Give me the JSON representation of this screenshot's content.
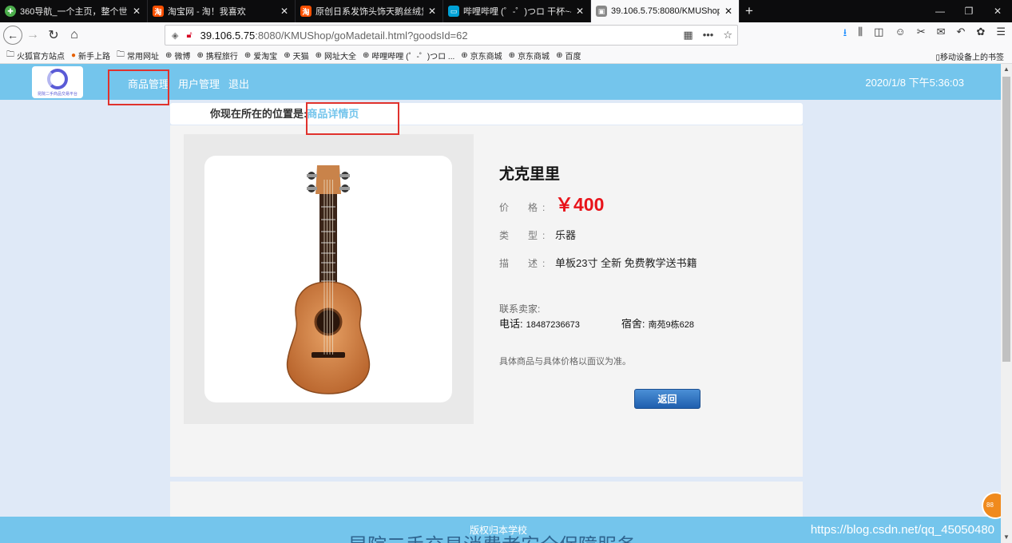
{
  "browser": {
    "tabs": [
      {
        "title": "360导航_一个主页，整个世界",
        "active": false,
        "fav_color": "#4cae4c"
      },
      {
        "title": "淘宝网 - 淘！我喜欢",
        "active": false,
        "fav_color": "#ff5000"
      },
      {
        "title": "原创日系发饰头饰天鹅丝绒复古",
        "active": false,
        "fav_color": "#ff5000"
      },
      {
        "title": "哔哩哔哩 (゜-゜)つロ 干杯~-bi",
        "active": false,
        "fav_color": "#00a1d6"
      },
      {
        "title": "39.106.5.75:8080/KMUShop/",
        "active": true,
        "fav_color": "#888888"
      }
    ],
    "url_host": "39.106.5.75",
    "url_rest": ":8080/KMUShop/goMadetail.html?goodsId=62",
    "bookmarks": [
      {
        "icon": "folder-icon",
        "label": "火狐官方站点"
      },
      {
        "icon": "firefox-icon",
        "label": "新手上路"
      },
      {
        "icon": "folder-icon",
        "label": "常用网址"
      },
      {
        "icon": "globe-icon",
        "label": "微博"
      },
      {
        "icon": "globe-icon",
        "label": "携程旅行"
      },
      {
        "icon": "globe-icon",
        "label": "爱淘宝"
      },
      {
        "icon": "globe-icon",
        "label": "天猫"
      },
      {
        "icon": "globe-icon",
        "label": "网址大全"
      },
      {
        "icon": "globe-icon",
        "label": "哔哩哔哩 (゜-゜)つロ ..."
      },
      {
        "icon": "globe-icon",
        "label": "京东商城"
      },
      {
        "icon": "globe-icon",
        "label": "京东商城"
      },
      {
        "icon": "globe-icon",
        "label": "百度"
      }
    ],
    "mobile_bookmarks": "移动设备上的书签"
  },
  "site": {
    "logo_text": "昆院二手商品交易平台",
    "nav": [
      "商品管理",
      "用户管理",
      "退出"
    ],
    "datetime": "2020/1/8 下午5:36:03",
    "breadcrumb_label": "你现在所在的位置是:",
    "breadcrumb_current": "商品详情页"
  },
  "product": {
    "name": "尤克里里",
    "price_label": "价　格:",
    "price": "￥400",
    "type_label": "类　型:",
    "type": "乐器",
    "desc_label": "描　述:",
    "desc": "单板23寸 全新 免费教学送书籍",
    "contact_title": "联系卖家:",
    "phone_label": "电话:",
    "phone": "18487236673",
    "dorm_label": "宿舍:",
    "dorm": "南苑9栋628",
    "note": "具体商品与具体价格以面议为准。",
    "back_button": "返回"
  },
  "footer": {
    "copyright": "版权归本学校",
    "slogan": "昆院二手交易消费者安全保障服务"
  },
  "watermark": "https://blog.csdn.net/qq_45050480",
  "orb_text": "88"
}
